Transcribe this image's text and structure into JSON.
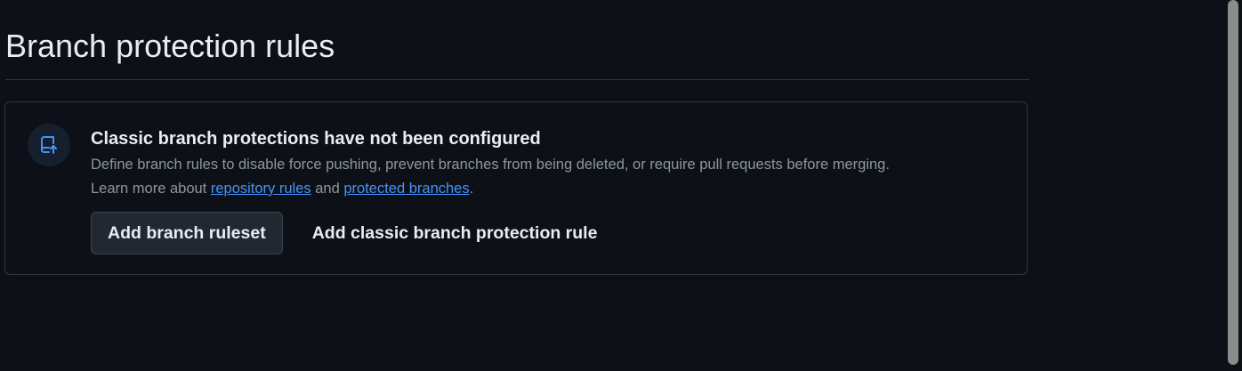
{
  "page": {
    "title": "Branch protection rules"
  },
  "blankslate": {
    "icon": "repo-push-icon",
    "heading": "Classic branch protections have not been configured",
    "description": "Define branch rules to disable force pushing, prevent branches from being deleted, or require pull requests before merging.",
    "learn_more_prefix": "Learn more about ",
    "link_repository_rules": "repository rules",
    "conjunction": " and ",
    "link_protected_branches": "protected branches",
    "suffix": "."
  },
  "actions": {
    "add_ruleset_label": "Add branch ruleset",
    "add_classic_rule_label": "Add classic branch protection rule"
  },
  "colors": {
    "background": "#0d1117",
    "border": "#30363d",
    "text_primary": "#e6edf3",
    "text_muted": "#8d96a0",
    "link": "#4493f8",
    "icon_accent": "#4493f8"
  }
}
